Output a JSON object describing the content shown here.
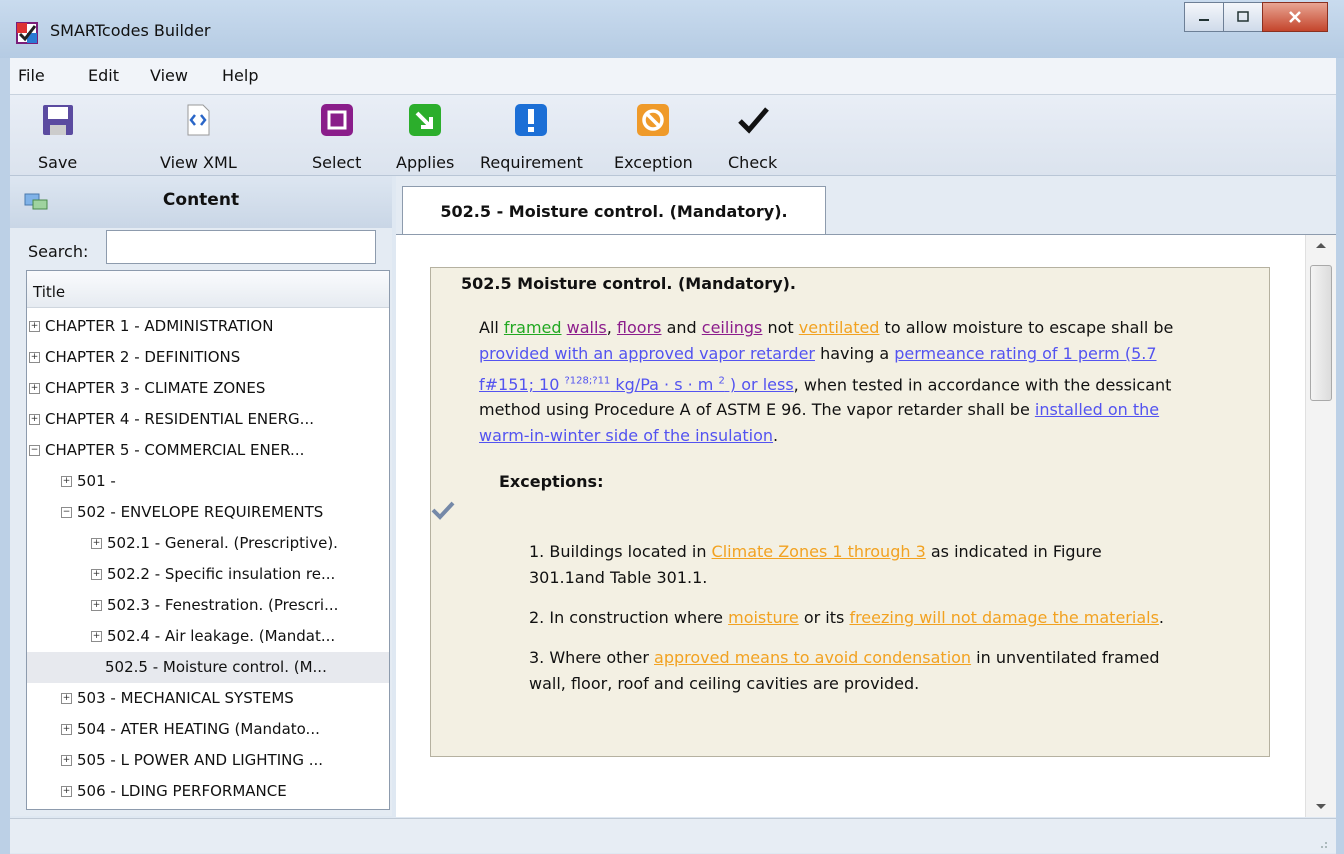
{
  "window": {
    "title": "SMARTcodes Builder"
  },
  "menu": [
    "File",
    "Edit",
    "View",
    "Help"
  ],
  "toolbar": {
    "save": "Save",
    "view_xml": "View XML",
    "select": "Select",
    "applies": "Applies",
    "requirement": "Requirement",
    "exception": "Exception",
    "check": "Check"
  },
  "sidebar": {
    "header": "Content",
    "search_label": "Search:",
    "search_value": "",
    "tree_header": "Title",
    "nodes": [
      {
        "label": "CHAPTER 1 - ADMINISTRATION",
        "expander": "+"
      },
      {
        "label": "CHAPTER 2 - DEFINITIONS",
        "expander": "+"
      },
      {
        "label": "CHAPTER 3 - CLIMATE ZONES",
        "expander": "+"
      },
      {
        "label": "CHAPTER 4 - RESIDENTIAL ENERG...",
        "expander": "+"
      },
      {
        "label": "CHAPTER 5 - COMMERCIAL ENER...",
        "expander": "−"
      },
      {
        "label": "501 -",
        "expander": "+"
      },
      {
        "label": "502 - ENVELOPE REQUIREMENTS",
        "expander": "−"
      },
      {
        "label": "502.1 - General. (Prescriptive).",
        "expander": "+"
      },
      {
        "label": "502.2 - Specific insulation re...",
        "expander": "+"
      },
      {
        "label": "502.3 - Fenestration. (Prescri...",
        "expander": "+"
      },
      {
        "label": "502.4 - Air leakage. (Mandat...",
        "expander": "+"
      },
      {
        "label": "502.5 - Moisture control. (M...",
        "expander": ""
      },
      {
        "label": "503 - MECHANICAL SYSTEMS",
        "expander": "+"
      },
      {
        "label": "504 - ATER HEATING (Mandato...",
        "expander": "+"
      },
      {
        "label": "505 - L POWER AND LIGHTING ...",
        "expander": "+"
      },
      {
        "label": "506 - LDING PERFORMANCE",
        "expander": "+"
      }
    ]
  },
  "document": {
    "tab": "502.5 - Moisture control. (Mandatory).",
    "heading": "502.5 Moisture control. (Mandatory).",
    "para": {
      "t1": "All ",
      "framed": "framed",
      "walls": "walls",
      "t2": ", ",
      "floors": "floors",
      "t3": " and ",
      "ceilings": "ceilings",
      "t4": " not ",
      "ventilated": "ventilated",
      "t5": " to allow moisture to escape shall be",
      "vapor": "provided with an approved vapor retarder",
      "t6": " having a ",
      "perm1": "permeance rating of 1 perm (5.7",
      "perm2a": "f#151; 10 ",
      "perm2sup": "?128;?11",
      "perm2b": " kg/Pa · s · m ",
      "perm2sup2": "2",
      "perm2c": " ) or less",
      "t7": ", when tested in accordance with the dessicant",
      "line4": "method using Procedure A of ASTM E 96. The vapor retarder shall be ",
      "install1": "installed on the",
      "install2": "warm-in-winter side of the insulation",
      "t8": "."
    },
    "exceptions_title": "Exceptions:",
    "ex1": {
      "a": "1. Buildings located in ",
      "lnk": "Climate Zones 1 through 3",
      "b": " as indicated in Figure",
      "c": "301.1and Table 301.1."
    },
    "ex2": {
      "a": "2. In construction where ",
      "lnk1": "moisture",
      "b": " or its ",
      "lnk2": "freezing will not damage the materials",
      "c": "."
    },
    "ex3": {
      "a": "3. Where other ",
      "lnk": "approved means to avoid condensation",
      "b": " in unventilated framed",
      "c": "wall, floor, roof and ceiling cavities are provided."
    }
  },
  "colors": {
    "framed": "#22a822",
    "purple": "#8c1d8c",
    "orange": "#f2a221",
    "blue": "#5353f0"
  }
}
